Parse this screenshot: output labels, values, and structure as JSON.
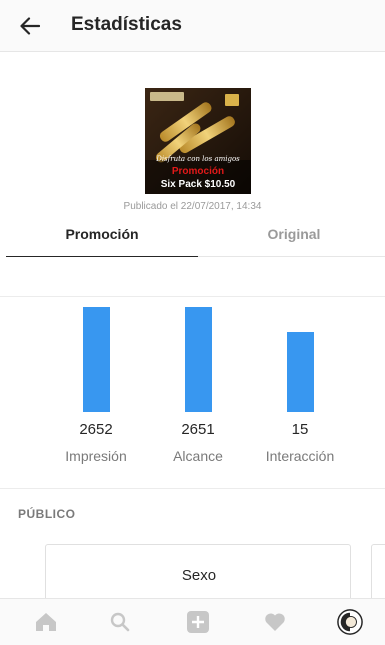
{
  "header": {
    "title": "Estadísticas"
  },
  "post": {
    "thumb_line1": "Disfruta con los amigos",
    "thumb_promo": "Promoción",
    "thumb_price": "Six Pack $10.50",
    "published": "Publicado el 22/07/2017, 14:34"
  },
  "tabs": [
    {
      "label": "Promoción",
      "active": true
    },
    {
      "label": "Original",
      "active": false
    }
  ],
  "chart_data": {
    "type": "bar",
    "categories": [
      "Impresión",
      "Alcance",
      "Interacción"
    ],
    "values": [
      2652,
      2651,
      15
    ],
    "value_labels": [
      "2652",
      "2651",
      "15"
    ],
    "bar_color": "#3897f0"
  },
  "audience": {
    "section_label": "PÚBLICO",
    "card_title": "Sexo"
  },
  "bottom_nav": [
    {
      "icon": "home-icon"
    },
    {
      "icon": "search-icon"
    },
    {
      "icon": "add-icon"
    },
    {
      "icon": "heart-icon"
    },
    {
      "icon": "profile-avatar-icon"
    }
  ]
}
